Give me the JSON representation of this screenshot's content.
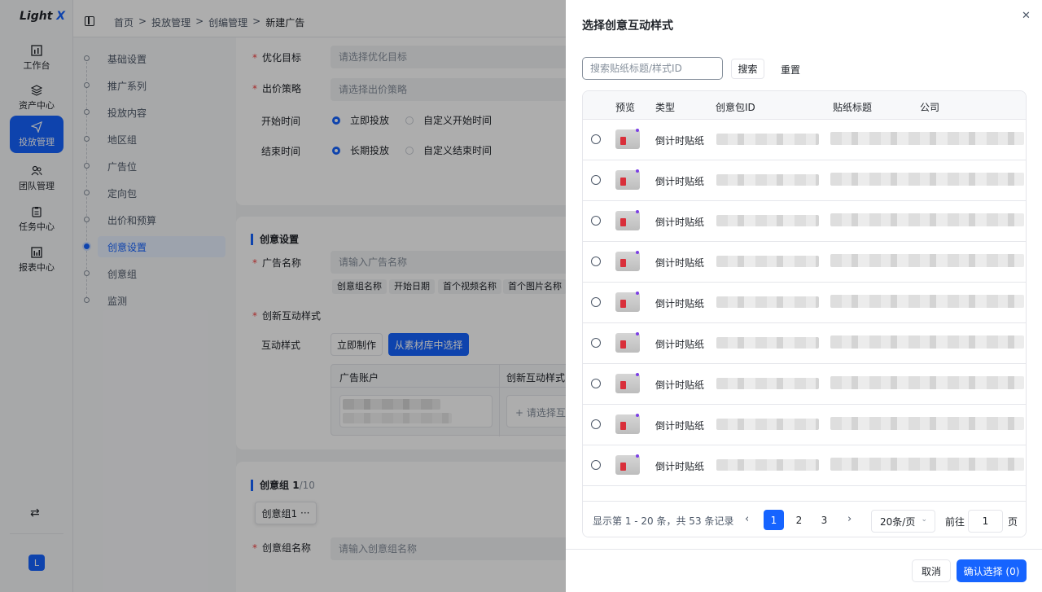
{
  "app": {
    "logo_light": "Light",
    "logo_x": "X"
  },
  "nav": {
    "items": [
      {
        "label": "工作台",
        "icon": "bar-chart-icon"
      },
      {
        "label": "资产中心",
        "icon": "layers-icon"
      },
      {
        "label": "投放管理",
        "icon": "send-icon"
      },
      {
        "label": "团队管理",
        "icon": "users-icon"
      },
      {
        "label": "任务中心",
        "icon": "clipboard-icon"
      },
      {
        "label": "报表中心",
        "icon": "report-icon"
      }
    ],
    "active_index": 2,
    "switch_glyph": "⇄",
    "avatar": "L"
  },
  "breadcrumb": {
    "items": [
      "首页",
      "投放管理",
      "创编管理"
    ],
    "current": "新建广告",
    "sep": ">"
  },
  "steps": {
    "items": [
      "基础设置",
      "推广系列",
      "投放内容",
      "地区组",
      "广告位",
      "定向包",
      "出价和预算",
      "创意设置",
      "创意组",
      "监测"
    ],
    "active_index": 7
  },
  "form": {
    "opt_goal_label": "优化目标",
    "opt_goal_placeholder": "请选择优化目标",
    "bid_label": "出价策略",
    "bid_placeholder": "请选择出价策略",
    "start_label": "开始时间",
    "start_opt1": "立即投放",
    "start_opt2": "自定义开始时间",
    "end_label": "结束时间",
    "end_opt1": "长期投放",
    "end_opt2": "自定义结束时间",
    "creative_title": "创意设置",
    "ad_name_label": "广告名称",
    "ad_name_placeholder": "请输入广告名称",
    "name_tags": [
      "创意组名称",
      "开始日期",
      "首个视频名称",
      "首个图片名称"
    ],
    "interaction_label": "创新互动样式",
    "style_label": "互动样式",
    "make_now": "立即制作",
    "from_library": "从素材库中选择",
    "table_col1": "广告账户",
    "table_col2": "创新互动样式",
    "select_placeholder": "+ 请选择互",
    "group_title": "创意组",
    "group_count": "1",
    "group_total": "/10",
    "group_tab": "创意组1",
    "group_tab_more": "···",
    "group_name_label": "创意组名称",
    "group_name_placeholder": "请输入创意组名称"
  },
  "drawer": {
    "title": "选择创意互动样式",
    "close": "✕",
    "search_placeholder": "搜索贴纸标题/样式ID",
    "search_btn": "搜索",
    "reset_btn": "重置",
    "columns": [
      "预览",
      "类型",
      "创意包ID",
      "贴纸标题",
      "公司"
    ],
    "rows": [
      {
        "type": "倒计时贴纸"
      },
      {
        "type": "倒计时贴纸"
      },
      {
        "type": "倒计时贴纸"
      },
      {
        "type": "倒计时贴纸"
      },
      {
        "type": "倒计时贴纸"
      },
      {
        "type": "倒计时贴纸"
      },
      {
        "type": "倒计时贴纸"
      },
      {
        "type": "倒计时贴纸"
      },
      {
        "type": "倒计时贴纸"
      }
    ],
    "pager": {
      "total_text": "显示第 1 - 20 条，共 53 条记录",
      "prev": "‹",
      "next": "›",
      "pages": [
        "1",
        "2",
        "3"
      ],
      "current": "1",
      "page_size": "20条/页",
      "goto_label": "前往",
      "goto_value": "1",
      "page_unit": "页"
    },
    "cancel": "取消",
    "confirm": "确认选择 (0)"
  },
  "colors": {
    "primary": "#1664ff",
    "required": "#f53f3f",
    "overlay": "rgba(0,0,0,0.32)"
  }
}
